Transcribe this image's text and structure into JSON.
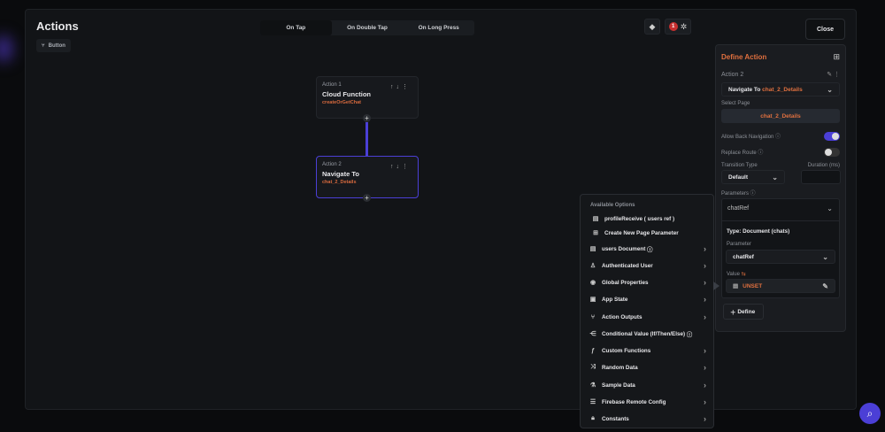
{
  "header": {
    "title": "Actions",
    "widget_chip": "Button",
    "tabs": [
      "On Tap",
      "On Double Tap",
      "On Long Press"
    ],
    "active_tab": "On Tap",
    "error_count": "1",
    "close_label": "Close"
  },
  "flow": {
    "actions": [
      {
        "label": "Action 1",
        "name": "Cloud Function",
        "detail": "createOrGetChat"
      },
      {
        "label": "Action 2",
        "name": "Navigate To",
        "detail": "chat_2_Details"
      }
    ]
  },
  "panel": {
    "title": "Define Action",
    "action_label": "Action 2",
    "action_type": "Navigate To",
    "action_target": "chat_2_Details",
    "select_page_label": "Select Page",
    "selected_page": "chat_2_Details",
    "allow_back_label": "Allow Back Navigation",
    "allow_back": true,
    "replace_route_label": "Replace Route",
    "replace_route": false,
    "transition_label": "Transition Type",
    "transition_value": "Default",
    "duration_label": "Duration (ms)",
    "duration_value": "",
    "parameters_label": "Parameters",
    "param_name": "chatRef",
    "param_type": "Type: Document (chats)",
    "parameter_label": "Parameter",
    "parameter_value": "chatRef",
    "value_label": "Value",
    "value": "UNSET",
    "define_label": "Define"
  },
  "menu": {
    "header": "Available Options",
    "options": [
      {
        "icon": "document-icon",
        "label": "profileReceive  ( users ref )"
      },
      {
        "icon": "add-box-icon",
        "label": "Create New Page Parameter"
      }
    ],
    "items": [
      {
        "icon": "document-icon",
        "label": "users Document",
        "info": true,
        "chevron": true
      },
      {
        "icon": "user-icon",
        "label": "Authenticated User",
        "chevron": true
      },
      {
        "icon": "globe-icon",
        "label": "Global Properties",
        "chevron": true
      },
      {
        "icon": "app-state-icon",
        "label": "App State",
        "chevron": true
      },
      {
        "icon": "action-outputs-icon",
        "label": "Action Outputs",
        "chevron": true
      },
      {
        "icon": "conditional-icon",
        "label": "Conditional Value (If/Then/Else)",
        "info": true,
        "chevron": false
      },
      {
        "icon": "function-icon",
        "label": "Custom Functions",
        "chevron": true
      },
      {
        "icon": "shuffle-icon",
        "label": "Random Data",
        "chevron": true
      },
      {
        "icon": "sample-data-icon",
        "label": "Sample Data",
        "chevron": true
      },
      {
        "icon": "remote-config-icon",
        "label": "Firebase Remote Config",
        "chevron": true
      },
      {
        "icon": "lock-icon",
        "label": "Constants",
        "chevron": true
      }
    ]
  }
}
